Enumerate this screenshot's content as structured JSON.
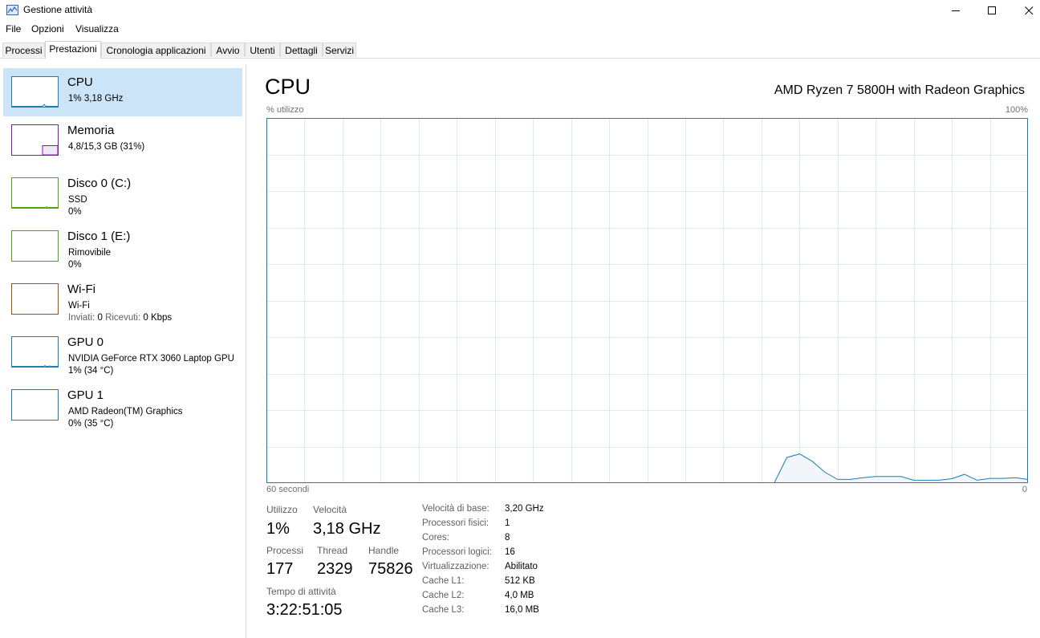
{
  "window": {
    "title": "Gestione attività",
    "minimize_glyph": "—",
    "maximize_glyph": "☐",
    "close_glyph": "✕"
  },
  "menu": [
    "File",
    "Opzioni",
    "Visualizza"
  ],
  "tabs": [
    {
      "label": "Processi",
      "active": false
    },
    {
      "label": "Prestazioni",
      "active": true
    },
    {
      "label": "Cronologia applicazioni",
      "active": false
    },
    {
      "label": "Avvio",
      "active": false
    },
    {
      "label": "Utenti",
      "active": false
    },
    {
      "label": "Dettagli",
      "active": false
    },
    {
      "label": "Servizi",
      "active": false
    }
  ],
  "sidebar": {
    "items": [
      {
        "title": "CPU",
        "sub1": "1% 3,18 GHz",
        "color": "#1a7fb5"
      },
      {
        "title": "Memoria",
        "sub1": "4,8/15,3 GB (31%)",
        "color": "#8b12ae",
        "fill": 0.31
      },
      {
        "title": "Disco 0 (C:)",
        "sub1": "SSD",
        "sub2": "0%",
        "color": "#4da60c"
      },
      {
        "title": "Disco 1 (E:)",
        "sub1": "Rimovibile",
        "sub2": "0%",
        "color": "#4da60c"
      },
      {
        "title": "Wi-Fi",
        "sub1": "Wi-Fi",
        "sub2_label_sent": "Inviati:",
        "sub2_value_sent": "0",
        "sub2_label_recv": "Ricevuti:",
        "sub2_value_recv": "0 Kbps",
        "color": "#a74f01"
      },
      {
        "title": "GPU 0",
        "sub1": "NVIDIA GeForce RTX 3060 Laptop GPU",
        "sub2": "1% (34 °C)",
        "color": "#1a7fb5"
      },
      {
        "title": "GPU 1",
        "sub1": "AMD Radeon(TM) Graphics",
        "sub2": "0% (35 °C)",
        "color": "#1a7fb5"
      }
    ]
  },
  "main": {
    "title": "CPU",
    "model": "AMD Ryzen 7 5800H with Radeon Graphics",
    "y_label": "% utilizzo",
    "y_max_label": "100%",
    "x_label": "60 secondi",
    "x_min_label": "0",
    "stats": {
      "utilizzo_label": "Utilizzo",
      "utilizzo_value": "1%",
      "velocita_label": "Velocità",
      "velocita_value": "3,18 GHz",
      "processi_label": "Processi",
      "processi_value": "177",
      "thread_label": "Thread",
      "thread_value": "2329",
      "handle_label": "Handle",
      "handle_value": "75826",
      "uptime_label": "Tempo di attività",
      "uptime_value": "3:22:51:05"
    },
    "specs": [
      {
        "label": "Velocità di base:",
        "value": "3,20 GHz"
      },
      {
        "label": "Processori fisici:",
        "value": "1"
      },
      {
        "label": "Cores:",
        "value": "8"
      },
      {
        "label": "Processori logici:",
        "value": "16"
      },
      {
        "label": "Virtualizzazione:",
        "value": "Abilitato"
      },
      {
        "label": "Cache L1:",
        "value": "512 KB"
      },
      {
        "label": "Cache L2:",
        "value": "4,0 MB"
      },
      {
        "label": "Cache L3:",
        "value": "16,0 MB"
      }
    ]
  },
  "chart_data": {
    "type": "area",
    "x_range_seconds": [
      60,
      0
    ],
    "ylim": [
      0,
      100
    ],
    "grid": true,
    "color": "#1a7fb5",
    "x": [
      60,
      59,
      58,
      57,
      56,
      55,
      54,
      53,
      52,
      51,
      50,
      49,
      48,
      47,
      46,
      45,
      44,
      43,
      42,
      41,
      40,
      39,
      38,
      37,
      36,
      35,
      34,
      33,
      32,
      31,
      30,
      29,
      28,
      27,
      26,
      25,
      24,
      23,
      22,
      21,
      20,
      19,
      18,
      17,
      16,
      15,
      14,
      13,
      12,
      11,
      10,
      9,
      8,
      7,
      6,
      5,
      4,
      3,
      2,
      1,
      0
    ],
    "values": [
      0,
      0,
      0,
      0,
      0,
      0,
      0,
      0,
      0,
      0,
      0,
      0,
      0,
      0,
      0,
      0,
      0,
      0,
      0,
      0,
      0,
      0,
      0,
      0,
      0,
      0,
      0,
      0,
      0,
      0,
      0,
      0,
      0,
      0,
      0,
      0,
      0,
      0,
      0,
      0,
      0,
      7,
      8,
      6,
      3,
      1,
      1,
      1.5,
      1.8,
      1.8,
      1.8,
      0.8,
      0.8,
      0.8,
      1.2,
      2.4,
      0.8,
      1.3,
      1.3,
      1.5,
      1
    ]
  }
}
